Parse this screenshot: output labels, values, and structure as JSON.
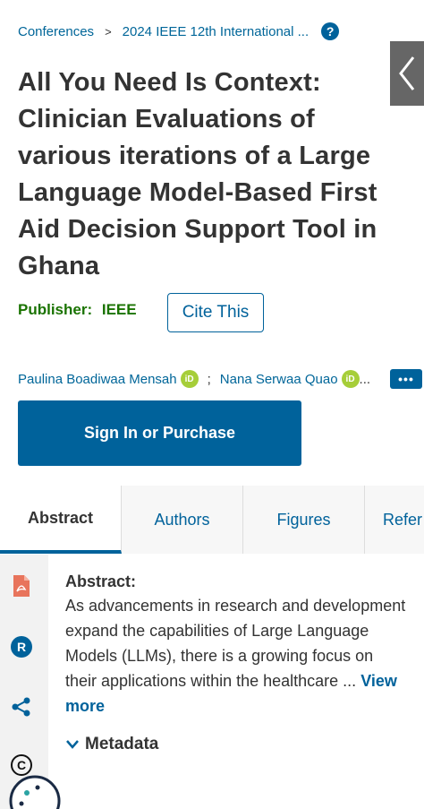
{
  "breadcrumb": {
    "items": [
      "Conferences",
      "2024 IEEE 12th International ..."
    ],
    "separator": ">",
    "help_icon": "?"
  },
  "side_tab": {
    "icon": "chevron-left-icon"
  },
  "article": {
    "title": "All You Need Is Context: Clinician Evaluations of various iterations of a Large Language Model-Based First Aid Decision Support Tool in Ghana",
    "publisher_label": "Publisher:",
    "publisher_name": "IEEE",
    "cite_label": "Cite This"
  },
  "authors": {
    "list": [
      "Paulina Boadiwaa Mensah",
      "Nana Serwaa Quao"
    ],
    "separator": ";",
    "more_label": "•••",
    "orcid_badge": "iD"
  },
  "sign_in": {
    "label": "Sign In or Purchase"
  },
  "tabs": [
    "Abstract",
    "Authors",
    "Figures",
    "Refer"
  ],
  "abstract": {
    "heading": "Abstract:",
    "text": "As advancements in research and development expand the capabilities of Large Language Models (LLMs), there is a growing focus on their applications within the healthcare ... ",
    "view_more": "View more"
  },
  "metadata": {
    "label": "Metadata"
  },
  "rail": {
    "icons": [
      "pdf-icon",
      "rights-icon",
      "share-icon",
      "copyright-icon"
    ],
    "rights_letter": "R",
    "copyright_symbol": "©"
  },
  "colors": {
    "accent": "#00629b",
    "publisher": "#1a7300",
    "orcid": "#a6ce39"
  }
}
